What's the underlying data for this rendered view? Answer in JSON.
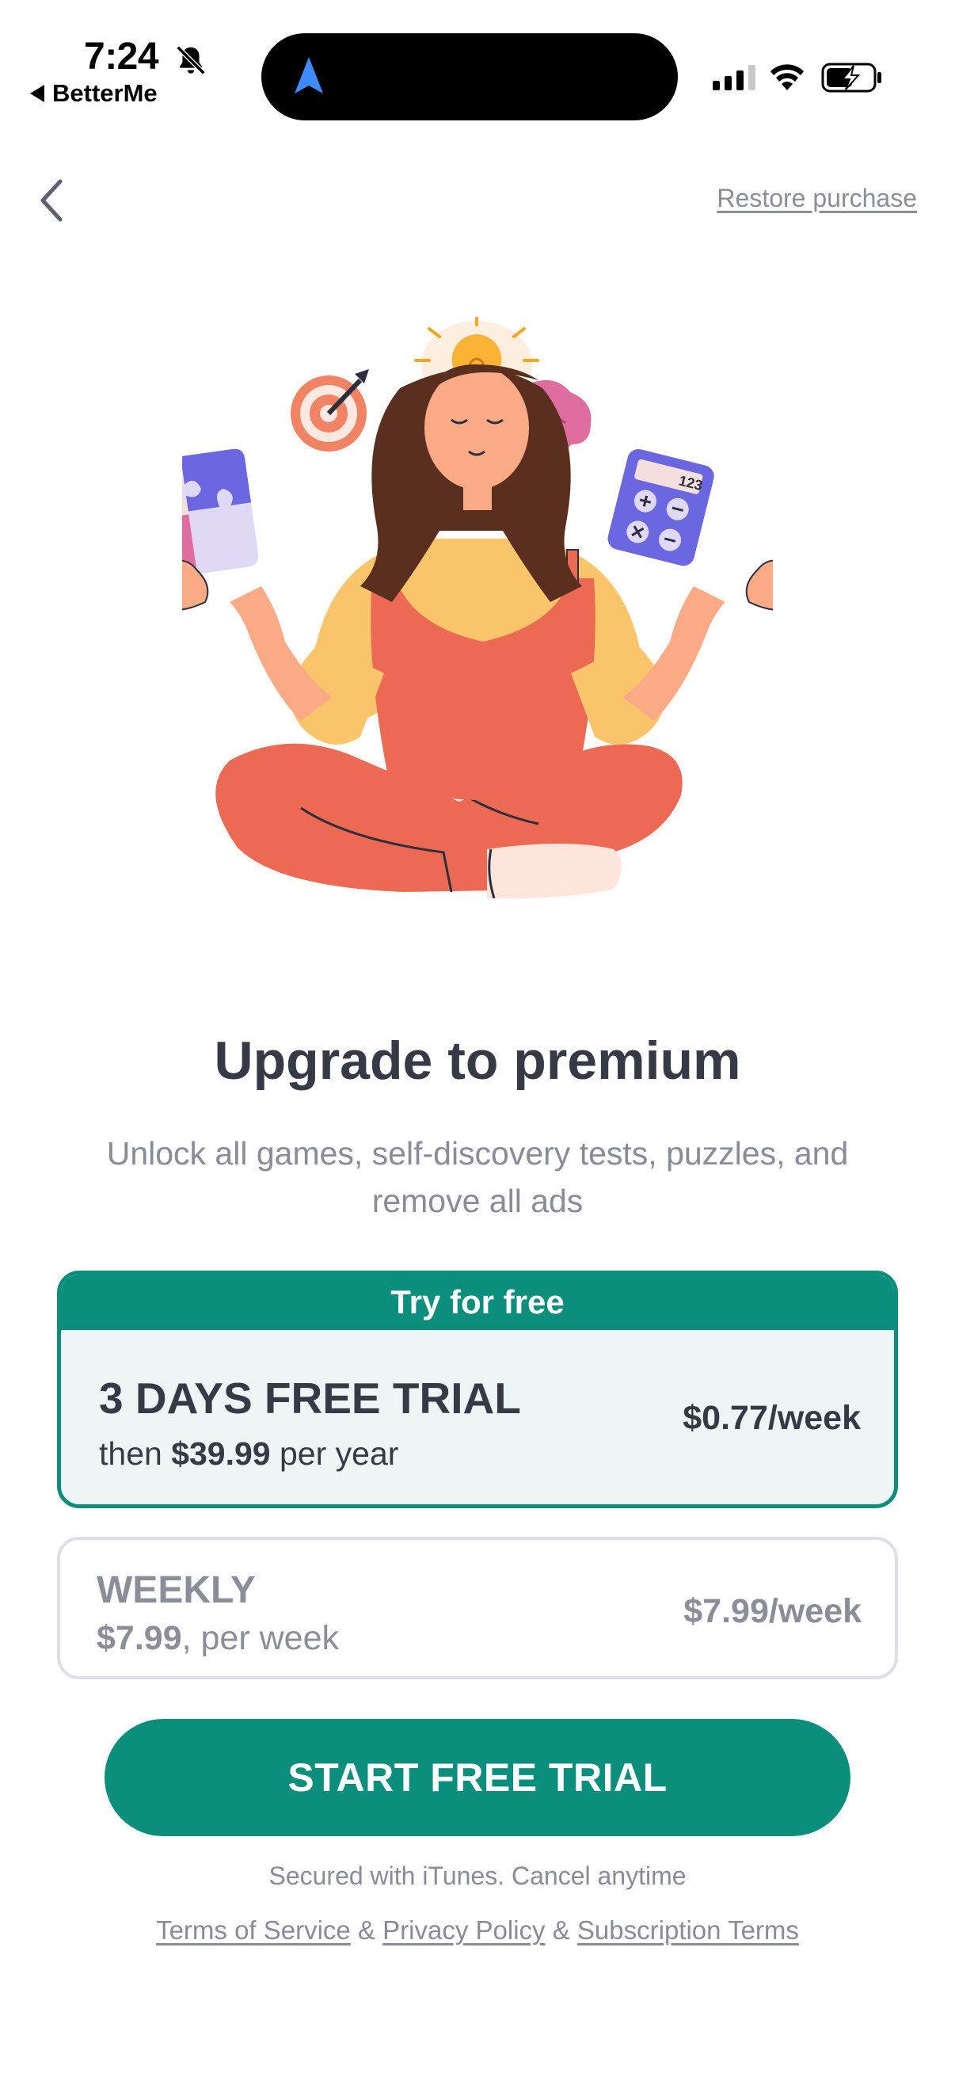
{
  "status_bar": {
    "time": "7:24",
    "back_app": "BetterMe"
  },
  "nav": {
    "restore_label": "Restore purchase"
  },
  "hero": {
    "title": "Upgrade to premium",
    "subtitle": "Unlock all games, self-discovery tests, puzzles, and remove all ads"
  },
  "plans": {
    "featured": {
      "banner": "Try for free",
      "name": "3 DAYS FREE TRIAL",
      "sub_prefix": "then ",
      "sub_price": "$39.99",
      "sub_suffix": " per year",
      "price": "$0.77/week"
    },
    "weekly": {
      "name": "WEEKLY",
      "sub_price": "$7.99",
      "sub_suffix": ", per week",
      "price": "$7.99/week"
    }
  },
  "cta_label": "START FREE TRIAL",
  "footer": {
    "secured": "Secured with iTunes. Cancel anytime",
    "terms": "Terms of Service",
    "amp1": " & ",
    "privacy": "Privacy Policy",
    "amp2": " & ",
    "subscription": "Subscription Terms"
  },
  "colors": {
    "accent": "#0b8e7b",
    "text": "#363a47",
    "muted": "#888c99"
  },
  "icons": [
    "bell-off-icon",
    "navigation-arrow-icon",
    "signal-icon",
    "wifi-icon",
    "battery-charging-icon",
    "chevron-left-icon"
  ]
}
